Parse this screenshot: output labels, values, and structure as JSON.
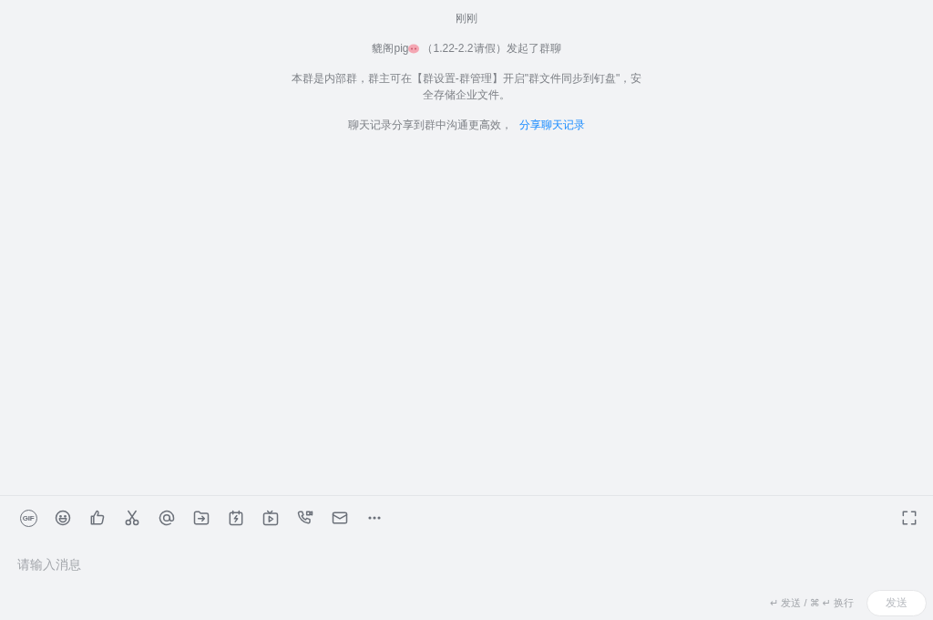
{
  "messages": [
    {
      "kind": "time",
      "text": "刚刚"
    },
    {
      "kind": "event",
      "actor": "貔阁pig",
      "text": "（1.22-2.2请假）发起了群聊"
    },
    {
      "kind": "notice",
      "text": "本群是内部群，群主可在【群设置-群管理】开启\"群文件同步到钉盘\"，安全存储企业文件。"
    },
    {
      "kind": "share",
      "text": "聊天记录分享到群中沟通更高效，",
      "link": "分享聊天记录"
    }
  ],
  "toolbar": {
    "gif_label": "GIF"
  },
  "composer": {
    "placeholder": "请输入消息",
    "hint": "↵ 发送 / ⌘ ↵ 换行",
    "send_button": "发送"
  }
}
